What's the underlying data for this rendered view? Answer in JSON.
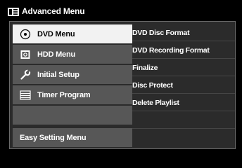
{
  "header": {
    "title": "Advanced Menu",
    "icon": "menu-list-icon"
  },
  "menu": {
    "items": [
      {
        "label": "DVD Menu",
        "icon": "disc-icon",
        "selected": true
      },
      {
        "label": "HDD Menu",
        "icon": "hdd-icon",
        "selected": false
      },
      {
        "label": "Initial Setup",
        "icon": "wrench-icon",
        "selected": false
      },
      {
        "label": "Timer Program",
        "icon": "list-icon",
        "selected": false
      }
    ],
    "footer_label": "Easy Setting Menu"
  },
  "submenu": {
    "options": [
      {
        "label": "DVD Disc Format"
      },
      {
        "label": "DVD Recording Format"
      },
      {
        "label": "Finalize"
      },
      {
        "label": "Disc Protect"
      },
      {
        "label": "Delete Playlist"
      }
    ]
  },
  "colors": {
    "background": "#000000",
    "panel": "#2b2b2b",
    "item": "#575757",
    "selected": "#f2f2f2",
    "text": "#ffffff"
  }
}
